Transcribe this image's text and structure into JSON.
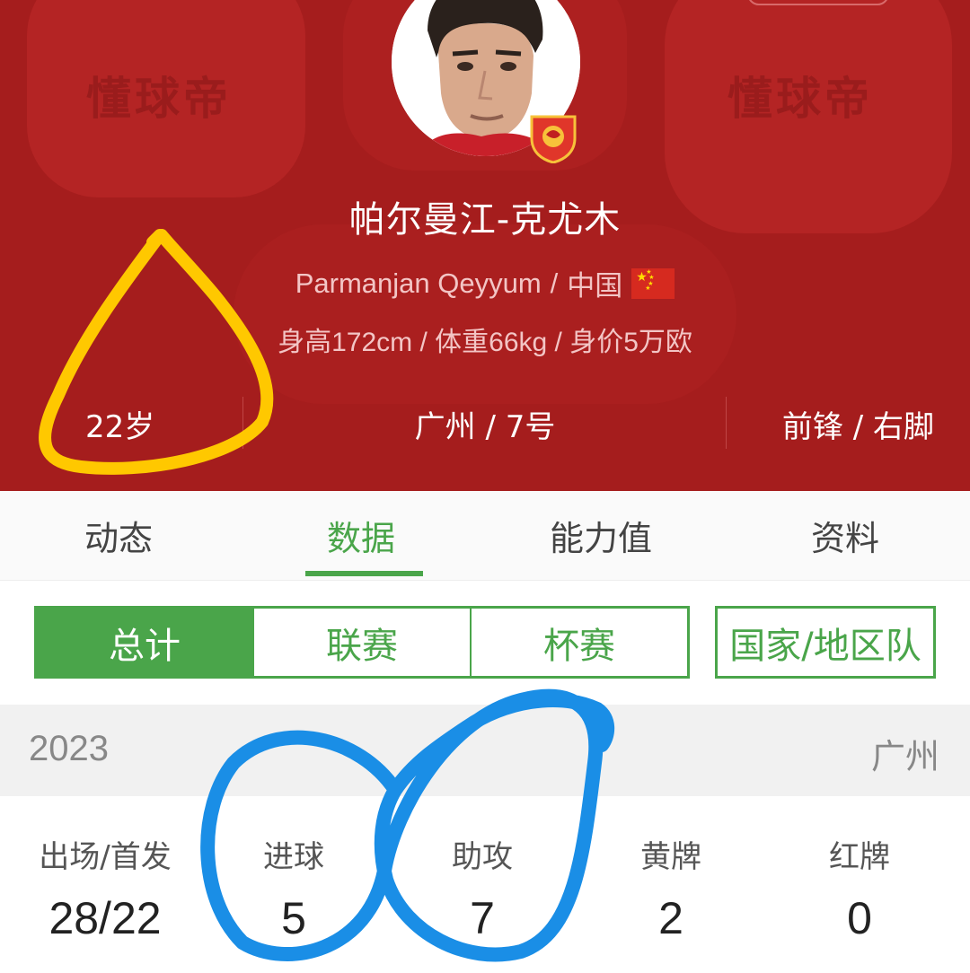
{
  "header": {
    "watermark": "懂球帝",
    "player_name": "帕尔曼江-克尤木",
    "english_name": "Parmanjan Qeyyum",
    "nationality": "中国",
    "separator": "/",
    "stats_line": "身高172cm / 体重66kg / 身价5万欧",
    "age": "22岁",
    "club_number": "广州 / 7号",
    "position_foot": "前锋 / 右脚"
  },
  "tabs": [
    {
      "label": "动态"
    },
    {
      "label": "数据",
      "active": true
    },
    {
      "label": "能力值"
    },
    {
      "label": "资料"
    }
  ],
  "filters": {
    "segments": [
      {
        "label": "总计",
        "active": true
      },
      {
        "label": "联赛"
      },
      {
        "label": "杯赛"
      }
    ],
    "national": "国家/地区队"
  },
  "season": {
    "year": "2023",
    "club": "广州"
  },
  "stats": [
    {
      "label": "出场/首发",
      "value": "28/22"
    },
    {
      "label": "进球",
      "value": "5"
    },
    {
      "label": "助攻",
      "value": "7"
    },
    {
      "label": "黄牌",
      "value": "2"
    },
    {
      "label": "红牌",
      "value": "0"
    }
  ],
  "colors": {
    "header_red": "#a51d1d",
    "accent_green": "#4aa54a",
    "annotation_yellow": "#ffc800",
    "annotation_blue": "#1a8ee6"
  },
  "icons": {
    "flag": "china-flag-icon",
    "badge": "club-badge-icon",
    "avatar": "player-avatar"
  }
}
